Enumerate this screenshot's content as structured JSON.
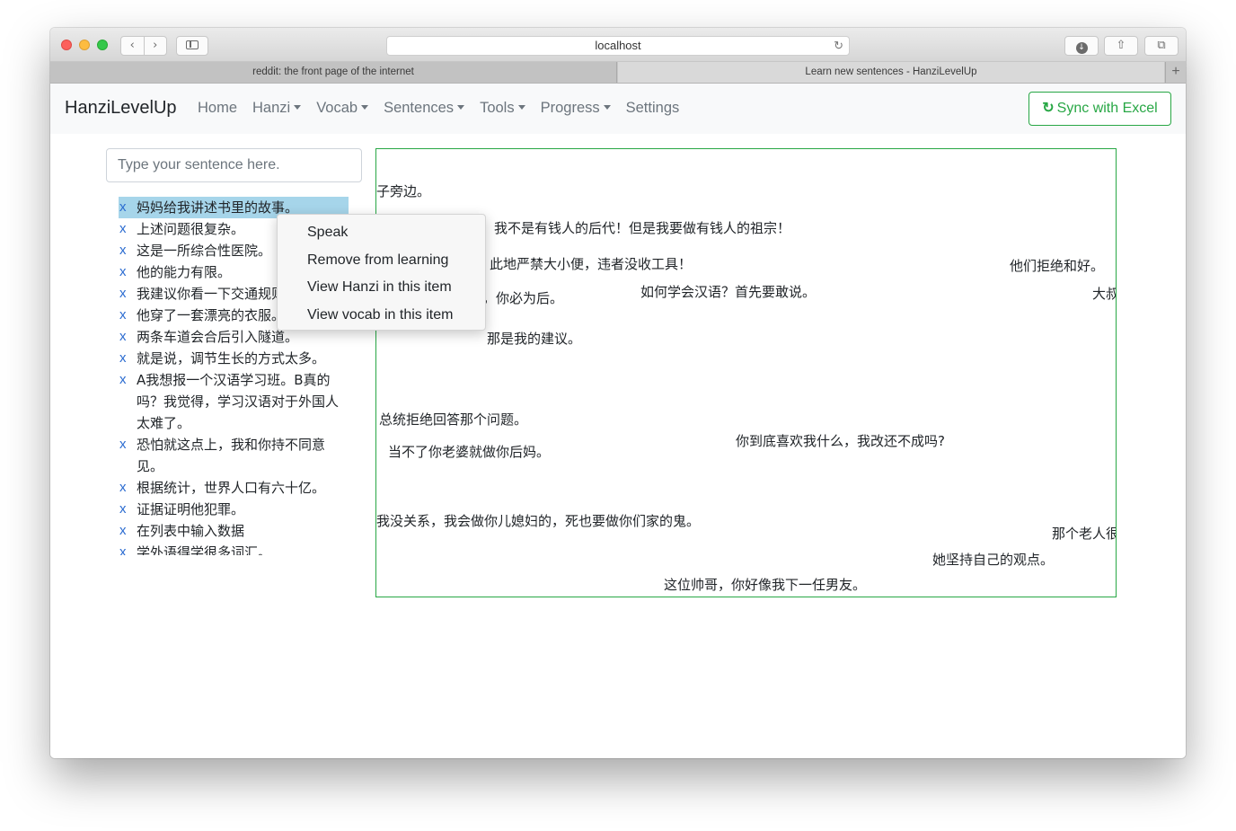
{
  "browser": {
    "url": "localhost",
    "tabs": [
      {
        "label": "reddit: the front page of the internet"
      },
      {
        "label": "Learn new sentences - HanziLevelUp"
      }
    ],
    "new_tab_symbol": "+",
    "back_symbol": "‹",
    "forward_symbol": "›",
    "reload_symbol": "↻",
    "download_symbol": "↓",
    "share_symbol": "⇧",
    "tabs_symbol": "⧉"
  },
  "navbar": {
    "brand": "HanziLevelUp",
    "items": [
      "Home",
      "Hanzi",
      "Vocab",
      "Sentences",
      "Tools",
      "Progress",
      "Settings"
    ],
    "sync_label": "Sync with Excel",
    "sync_icon": "↻"
  },
  "input": {
    "placeholder": "Type your sentence here."
  },
  "sentence_list": {
    "remove_symbol": "x",
    "items": [
      "妈妈给我讲述书里的故事。",
      "上述问题很复杂。",
      "这是一所综合性医院。",
      "他的能力有限。",
      "我建议你看一下交通规则。",
      "他穿了一套漂亮的衣服。",
      "两条车道会合后引入隧道。",
      "就是说，调节生长的方式太多。",
      "A我想报一个汉语学习班。B真的吗？我觉得，学习汉语对于外国人太难了。",
      "恐怕就这点上，我和你持不同意见。",
      "根据统计，世界人口有六十亿。",
      "证据证明他犯罪。",
      "在列表中输入数据",
      "学外语得学很多词汇。"
    ]
  },
  "floating_sentences": [
    "子旁边。",
    "我不是有钱人的后代！但是我要做有钱人的祖宗！",
    "此地严禁大小便，违者没收工具！",
    "他们拒绝和好。",
    "，你必为后。",
    "如何学会汉语？首先要敢说。",
    "大叔",
    "那是我的建议。",
    "总统拒绝回答那个问题。",
    "你到底喜欢我什么，我改还不成吗?",
    "当不了你老婆就做你后妈。",
    "我没关系，我会做你儿媳妇的，死也要做你们家的鬼。",
    "那个老人很",
    "她坚持自己的观点。",
    "这位帅哥，你好像我下一任男友。"
  ],
  "context_menu": {
    "items": [
      "Speak",
      "Remove from learning",
      "View Hanzi in this item",
      "View vocab in this item"
    ]
  },
  "colors": {
    "success": "#28a745",
    "link": "#2a6bd0",
    "selection": "#a6d5ea"
  }
}
